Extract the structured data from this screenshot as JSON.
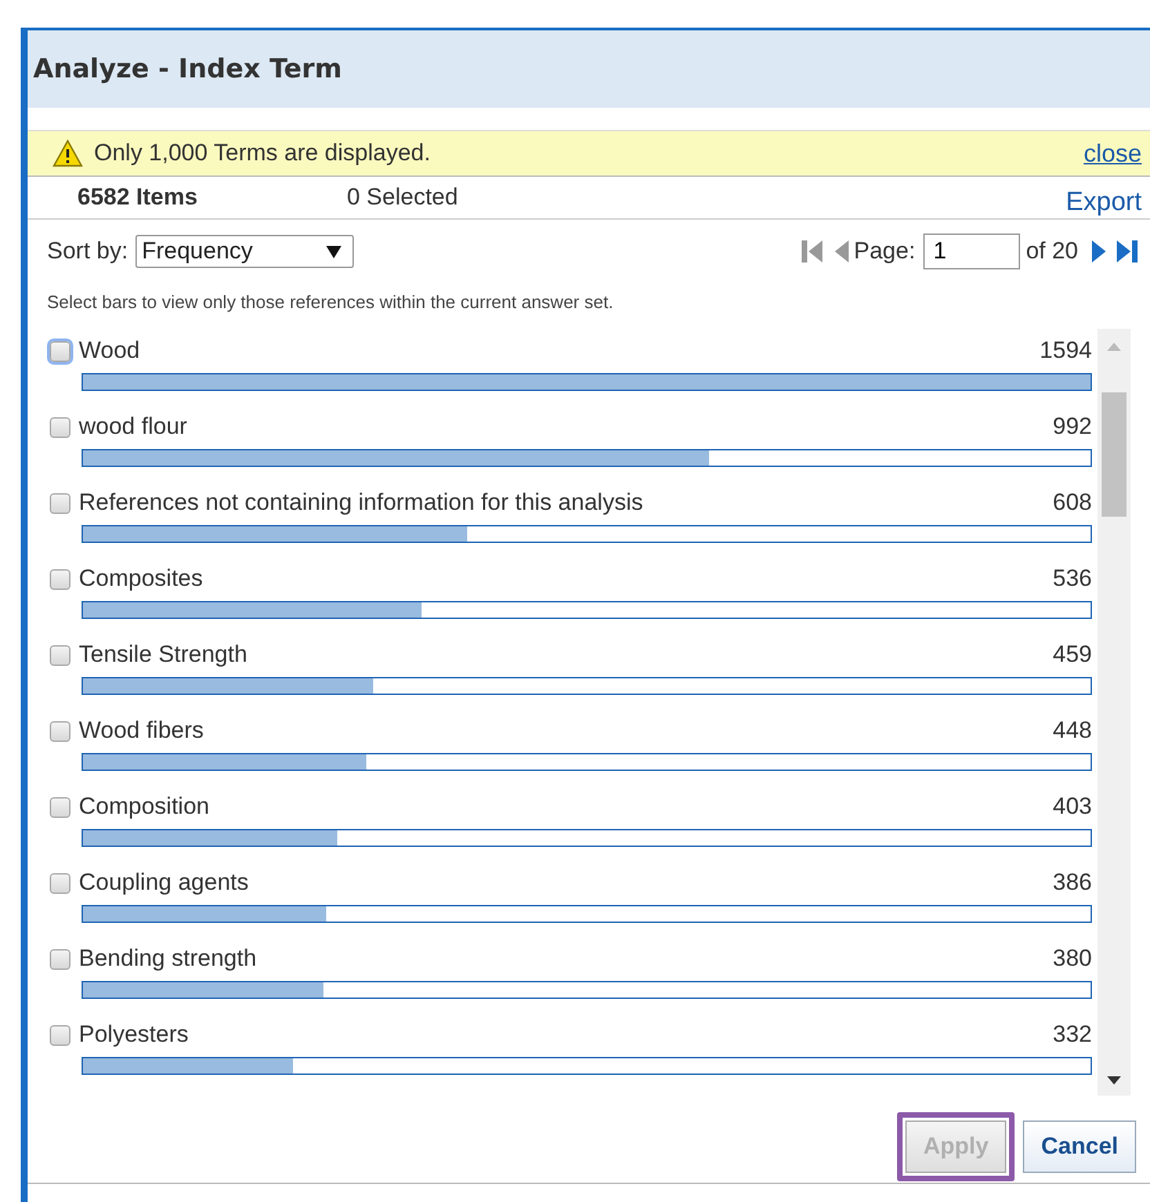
{
  "dialog": {
    "title": "Analyze - Index Term"
  },
  "notice": {
    "text": "Only 1,000 Terms are displayed.",
    "close": "close"
  },
  "summary": {
    "items": "6582 Items",
    "selected": "0 Selected",
    "export": "Export"
  },
  "sort": {
    "label": "Sort by:",
    "value": "Frequency"
  },
  "pager": {
    "label": "Page:",
    "value": "1",
    "of": "of 20"
  },
  "hint": "Select bars to view only those references within the current answer set.",
  "terms": [
    {
      "label": "Wood",
      "count": "1594",
      "level": 1.0,
      "checked": false,
      "focused": true
    },
    {
      "label": "wood flour",
      "count": "992",
      "level": 0.622,
      "checked": false,
      "focused": false
    },
    {
      "label": "References not containing information for this analysis",
      "count": "608",
      "level": 0.381,
      "checked": false,
      "focused": false
    },
    {
      "label": "Composites",
      "count": "536",
      "level": 0.336,
      "checked": false,
      "focused": false
    },
    {
      "label": "Tensile Strength",
      "count": "459",
      "level": 0.288,
      "checked": false,
      "focused": false
    },
    {
      "label": "Wood fibers",
      "count": "448",
      "level": 0.281,
      "checked": false,
      "focused": false
    },
    {
      "label": "Composition",
      "count": "403",
      "level": 0.253,
      "checked": false,
      "focused": false
    },
    {
      "label": "Coupling agents",
      "count": "386",
      "level": 0.242,
      "checked": false,
      "focused": false
    },
    {
      "label": "Bending strength",
      "count": "380",
      "level": 0.238,
      "checked": false,
      "focused": false
    },
    {
      "label": "Polyesters",
      "count": "332",
      "level": 0.208,
      "checked": false,
      "focused": false
    }
  ],
  "buttons": [
    {
      "label": "Apply",
      "disabled": true,
      "highlighted": true
    },
    {
      "label": "Cancel",
      "disabled": false,
      "highlighted": false
    }
  ]
}
